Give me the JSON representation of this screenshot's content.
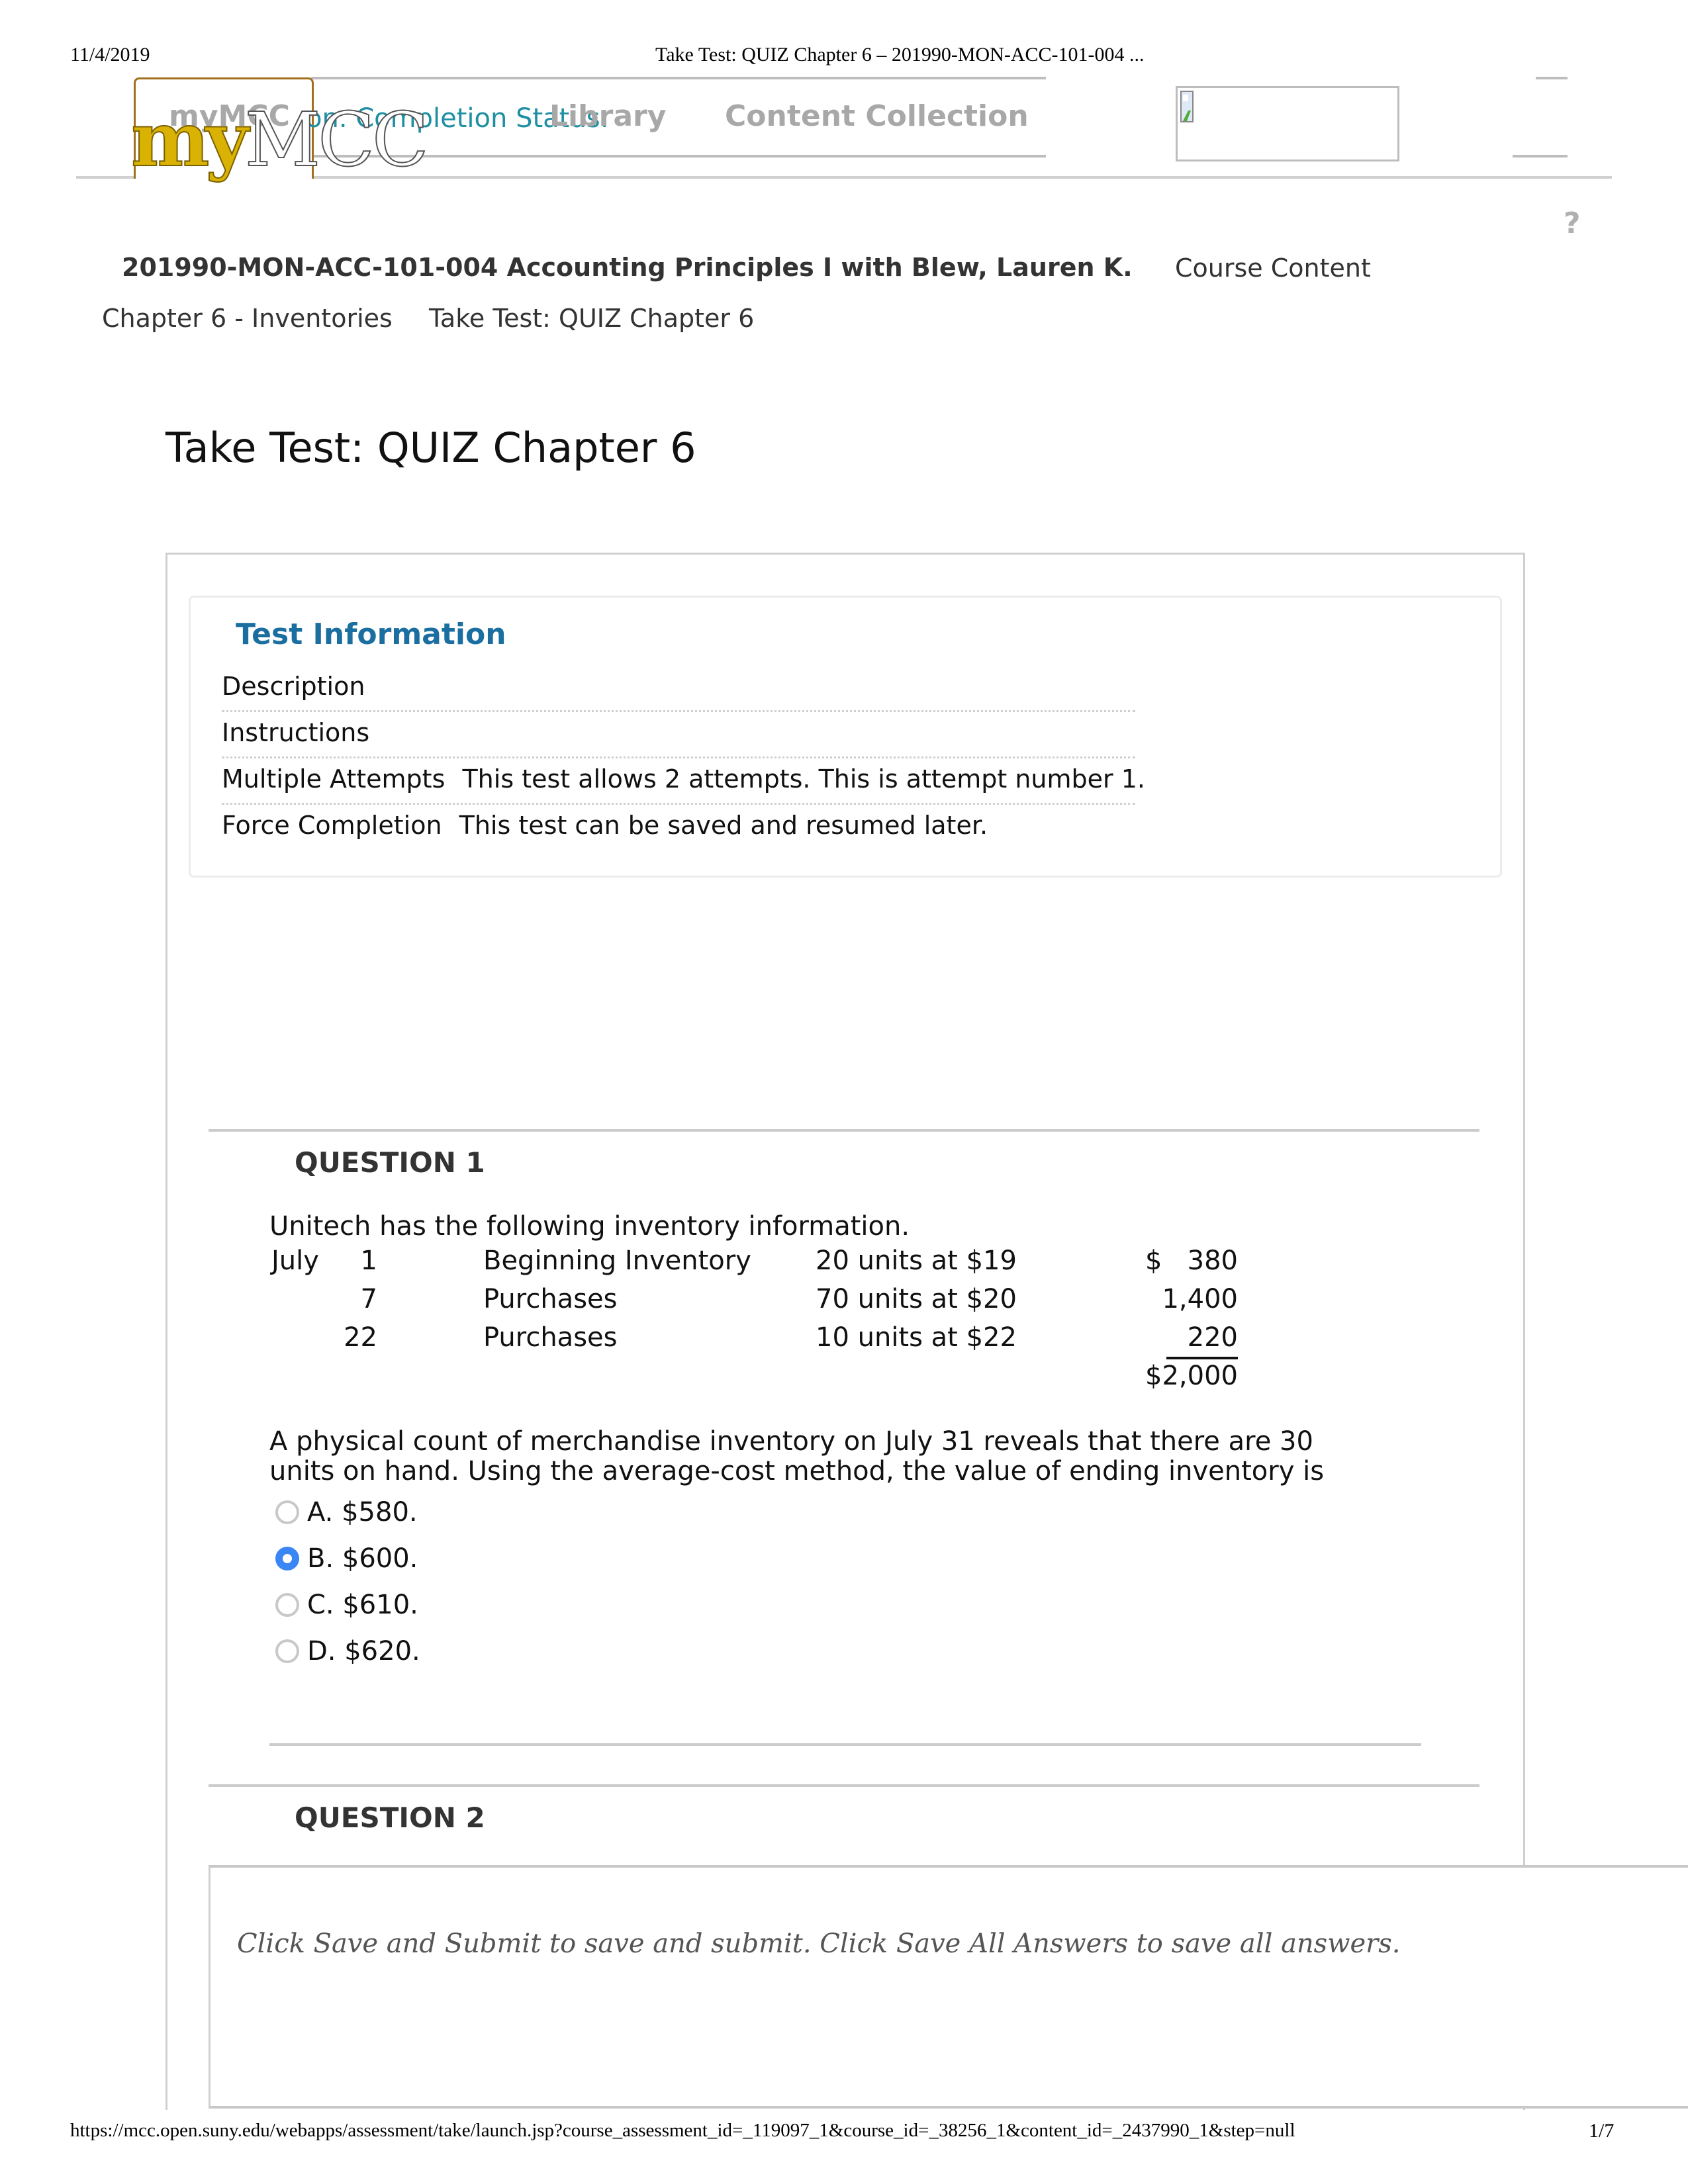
{
  "print_header": {
    "date": "11/4/2019",
    "title": "Take Test: QUIZ Chapter 6 – 201990-MON-ACC-101-004 ..."
  },
  "top_nav": {
    "logo_my": "my",
    "logo_mcc": "MCC",
    "overlap_text_gray": "myMCC",
    "completion_status": "on. Completion Status:",
    "library": "Library",
    "content_collection": "Content Collection",
    "broken_image_icon": "broken-image-icon"
  },
  "course_header": {
    "course_title": "201990-MON-ACC-101-004 Accounting Principles I with Blew, Lauren K.",
    "course_content_link": "Course Content",
    "help_icon": "?"
  },
  "breadcrumb": {
    "items": [
      "Chapter 6 - Inventories",
      "Take Test: QUIZ Chapter 6"
    ]
  },
  "page_title": "Take Test: QUIZ Chapter 6",
  "test_information": {
    "heading": "Test Information",
    "rows": [
      {
        "label": "Description",
        "value": ""
      },
      {
        "label": "Instructions",
        "value": ""
      },
      {
        "label": "Multiple Attempts",
        "value": "This test allows 2 attempts. This is attempt number 1."
      },
      {
        "label": "Force Completion",
        "value": "This test can be saved and resumed later."
      }
    ]
  },
  "questions": [
    {
      "title": "QUESTION 1",
      "intro": "Unitech has the following inventory information.",
      "inventory_table": [
        {
          "month": "July",
          "day": "1",
          "description": "Beginning Inventory",
          "units": "20 units at $19",
          "amount": "$   380"
        },
        {
          "month": "",
          "day": "7",
          "description": "Purchases",
          "units": "70 units at $20",
          "amount": "1,400"
        },
        {
          "month": "",
          "day": "22",
          "description": "Purchases",
          "units": "10 units at $22",
          "amount": "220"
        }
      ],
      "total": "$2,000",
      "prompt_line1": "A physical count of merchandise inventory on July 31 reveals that there are 30",
      "prompt_line2": "units on hand. Using the average-cost method, the value of ending inventory is",
      "choices": [
        {
          "label": "A. $580.",
          "selected": false
        },
        {
          "label": "B. $600.",
          "selected": true
        },
        {
          "label": "C. $610.",
          "selected": false
        },
        {
          "label": "D. $620.",
          "selected": false
        }
      ]
    },
    {
      "title": "QUESTION 2"
    }
  ],
  "submit_bar": {
    "instruction": "Click Save and Submit to save and submit. Click Save All Answers to save all answers."
  },
  "print_footer": {
    "url": "https://mcc.open.suny.edu/webapps/assessment/take/launch.jsp?course_assessment_id=_119097_1&course_id=_38256_1&content_id=_2437990_1&step=null",
    "page": "1/7"
  },
  "colors": {
    "accent_blue": "#1a6ea0",
    "teal_link": "#1f8fa3",
    "radio_selected": "#3a86f5",
    "logo_gold": "#d9b204"
  }
}
